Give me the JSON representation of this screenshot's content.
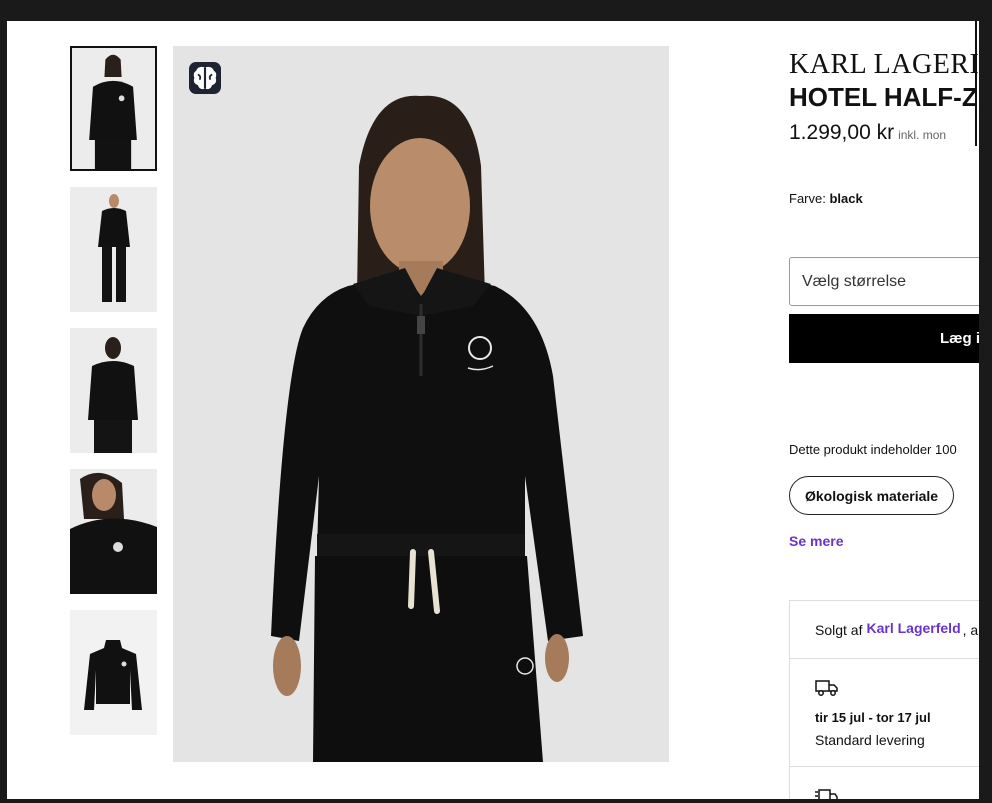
{
  "product": {
    "brand": "KARL LAGERI",
    "name": "HOTEL HALF-Z",
    "price": "1.299,00 kr",
    "price_note": "inkl. mon",
    "color_label": "Farve:",
    "color_value": "black"
  },
  "size_select": {
    "placeholder": "Vælg størrelse"
  },
  "add_to_cart": {
    "label": "Læg i"
  },
  "sustainability": {
    "contains_text": "Dette produkt indeholder 100",
    "badge": "Økologisk materiale",
    "see_more": "Se mere"
  },
  "seller": {
    "prefix": "Solgt af",
    "name": "Karl Lagerfeld",
    "suffix": ", a"
  },
  "delivery": {
    "dates": "tir 15 jul - tor 17 jul",
    "type": "Standard levering"
  },
  "gallery": {
    "thumbnails": [
      "front-upper",
      "front-full",
      "back",
      "side-closeup",
      "product-flat"
    ],
    "active_index": 0
  },
  "colors": {
    "purple_link": "#6a33c9",
    "button_bg": "#000000",
    "badge_bg": "#1f2433"
  }
}
